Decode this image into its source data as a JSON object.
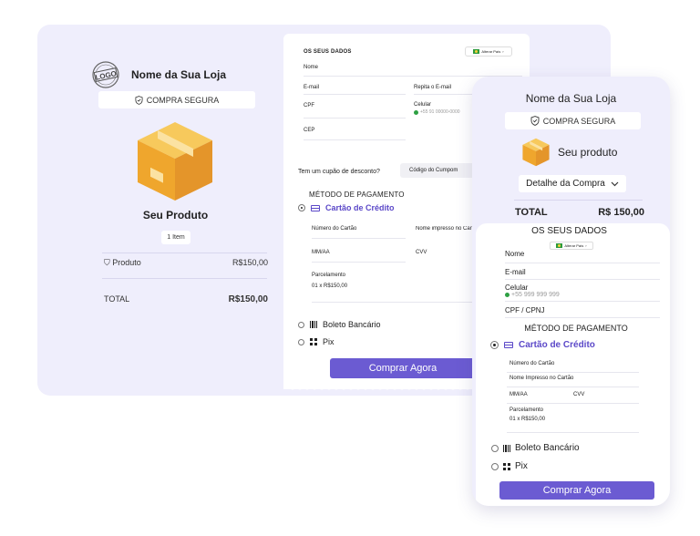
{
  "brand": {
    "logo_text": "LOGO",
    "accent": "#6b5bd2",
    "link_color": "#5b48c8",
    "background": "#efeefc"
  },
  "desktop": {
    "store_name": "Nome da Sua Loja",
    "secure_label": "COMPRA SEGURA",
    "product_title": "Seu Produto",
    "items_count": "1 Item",
    "product_label": "Produto",
    "product_price": "R$150,00",
    "total_label": "TOTAL",
    "total_value": "R$150,00",
    "form": {
      "section_title": "OS SEUS DADOS",
      "change_country": "Alterar País",
      "fields": {
        "name": "Nome",
        "email": "E-mail",
        "repeat_email": "Repita o E-mail",
        "cpf": "CPF",
        "phone": "Celular",
        "phone_hint": "+55 91 00000-0000",
        "cep": "CEP"
      },
      "coupon_question": "Tem um cupão de desconto?",
      "coupon_placeholder": "Código do Cumpom",
      "payment_title": "MÉTODO DE PAGAMENTO",
      "credit_card": "Cartão de Crédito",
      "card_number": "Número do Cartão",
      "card_name": "Nome impresso no Cartão",
      "expiry": "MM/AA",
      "cvv": "CVV",
      "installments_label": "Parcelamento",
      "installments_value": "01 x R$150,00",
      "boleto": "Boleto Bancário",
      "pix": "Pix",
      "buy_button": "Comprar Agora"
    }
  },
  "mobile": {
    "store_name": "Nome da Sua Loja",
    "secure_label": "COMPRA SEGURA",
    "product_label": "Seu produto",
    "purchase_detail": "Detalhe da Compra",
    "total_label": "TOTAL",
    "total_value": "R$ 150,00",
    "data_title": "OS SEUS DADOS",
    "change_country": "Alterar País",
    "name": "Nome",
    "email": "E-mail",
    "phone": "Celular",
    "phone_hint": "+55 999 999 999",
    "cpf_cnpj": "CPF / CPNJ",
    "payment_title": "MÉTODO DE PAGAMENTO",
    "credit_card": "Cartão de Crédito",
    "card_number": "Número do Cartão",
    "card_name": "Nome Impresso no Cartão",
    "expiry": "MM/AA",
    "cvv": "CVV",
    "installments_label": "Parcelamento",
    "installments_value": "01 x R$150,00",
    "boleto": "Boleto Bancário",
    "pix": "Pix",
    "buy_button": "Comprar Agora"
  }
}
